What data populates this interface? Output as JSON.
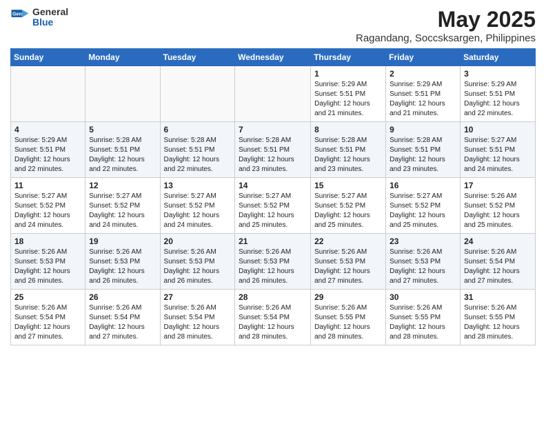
{
  "header": {
    "logo_general": "General",
    "logo_blue": "Blue",
    "title": "May 2025",
    "location": "Ragandang, Soccsksargen, Philippines"
  },
  "days_of_week": [
    "Sunday",
    "Monday",
    "Tuesday",
    "Wednesday",
    "Thursday",
    "Friday",
    "Saturday"
  ],
  "weeks": [
    [
      {
        "day": "",
        "info": ""
      },
      {
        "day": "",
        "info": ""
      },
      {
        "day": "",
        "info": ""
      },
      {
        "day": "",
        "info": ""
      },
      {
        "day": "1",
        "info": "Sunrise: 5:29 AM\nSunset: 5:51 PM\nDaylight: 12 hours\nand 21 minutes."
      },
      {
        "day": "2",
        "info": "Sunrise: 5:29 AM\nSunset: 5:51 PM\nDaylight: 12 hours\nand 21 minutes."
      },
      {
        "day": "3",
        "info": "Sunrise: 5:29 AM\nSunset: 5:51 PM\nDaylight: 12 hours\nand 22 minutes."
      }
    ],
    [
      {
        "day": "4",
        "info": "Sunrise: 5:29 AM\nSunset: 5:51 PM\nDaylight: 12 hours\nand 22 minutes."
      },
      {
        "day": "5",
        "info": "Sunrise: 5:28 AM\nSunset: 5:51 PM\nDaylight: 12 hours\nand 22 minutes."
      },
      {
        "day": "6",
        "info": "Sunrise: 5:28 AM\nSunset: 5:51 PM\nDaylight: 12 hours\nand 22 minutes."
      },
      {
        "day": "7",
        "info": "Sunrise: 5:28 AM\nSunset: 5:51 PM\nDaylight: 12 hours\nand 23 minutes."
      },
      {
        "day": "8",
        "info": "Sunrise: 5:28 AM\nSunset: 5:51 PM\nDaylight: 12 hours\nand 23 minutes."
      },
      {
        "day": "9",
        "info": "Sunrise: 5:28 AM\nSunset: 5:51 PM\nDaylight: 12 hours\nand 23 minutes."
      },
      {
        "day": "10",
        "info": "Sunrise: 5:27 AM\nSunset: 5:51 PM\nDaylight: 12 hours\nand 24 minutes."
      }
    ],
    [
      {
        "day": "11",
        "info": "Sunrise: 5:27 AM\nSunset: 5:52 PM\nDaylight: 12 hours\nand 24 minutes."
      },
      {
        "day": "12",
        "info": "Sunrise: 5:27 AM\nSunset: 5:52 PM\nDaylight: 12 hours\nand 24 minutes."
      },
      {
        "day": "13",
        "info": "Sunrise: 5:27 AM\nSunset: 5:52 PM\nDaylight: 12 hours\nand 24 minutes."
      },
      {
        "day": "14",
        "info": "Sunrise: 5:27 AM\nSunset: 5:52 PM\nDaylight: 12 hours\nand 25 minutes."
      },
      {
        "day": "15",
        "info": "Sunrise: 5:27 AM\nSunset: 5:52 PM\nDaylight: 12 hours\nand 25 minutes."
      },
      {
        "day": "16",
        "info": "Sunrise: 5:27 AM\nSunset: 5:52 PM\nDaylight: 12 hours\nand 25 minutes."
      },
      {
        "day": "17",
        "info": "Sunrise: 5:26 AM\nSunset: 5:52 PM\nDaylight: 12 hours\nand 25 minutes."
      }
    ],
    [
      {
        "day": "18",
        "info": "Sunrise: 5:26 AM\nSunset: 5:53 PM\nDaylight: 12 hours\nand 26 minutes."
      },
      {
        "day": "19",
        "info": "Sunrise: 5:26 AM\nSunset: 5:53 PM\nDaylight: 12 hours\nand 26 minutes."
      },
      {
        "day": "20",
        "info": "Sunrise: 5:26 AM\nSunset: 5:53 PM\nDaylight: 12 hours\nand 26 minutes."
      },
      {
        "day": "21",
        "info": "Sunrise: 5:26 AM\nSunset: 5:53 PM\nDaylight: 12 hours\nand 26 minutes."
      },
      {
        "day": "22",
        "info": "Sunrise: 5:26 AM\nSunset: 5:53 PM\nDaylight: 12 hours\nand 27 minutes."
      },
      {
        "day": "23",
        "info": "Sunrise: 5:26 AM\nSunset: 5:53 PM\nDaylight: 12 hours\nand 27 minutes."
      },
      {
        "day": "24",
        "info": "Sunrise: 5:26 AM\nSunset: 5:54 PM\nDaylight: 12 hours\nand 27 minutes."
      }
    ],
    [
      {
        "day": "25",
        "info": "Sunrise: 5:26 AM\nSunset: 5:54 PM\nDaylight: 12 hours\nand 27 minutes."
      },
      {
        "day": "26",
        "info": "Sunrise: 5:26 AM\nSunset: 5:54 PM\nDaylight: 12 hours\nand 27 minutes."
      },
      {
        "day": "27",
        "info": "Sunrise: 5:26 AM\nSunset: 5:54 PM\nDaylight: 12 hours\nand 28 minutes."
      },
      {
        "day": "28",
        "info": "Sunrise: 5:26 AM\nSunset: 5:54 PM\nDaylight: 12 hours\nand 28 minutes."
      },
      {
        "day": "29",
        "info": "Sunrise: 5:26 AM\nSunset: 5:55 PM\nDaylight: 12 hours\nand 28 minutes."
      },
      {
        "day": "30",
        "info": "Sunrise: 5:26 AM\nSunset: 5:55 PM\nDaylight: 12 hours\nand 28 minutes."
      },
      {
        "day": "31",
        "info": "Sunrise: 5:26 AM\nSunset: 5:55 PM\nDaylight: 12 hours\nand 28 minutes."
      }
    ]
  ]
}
